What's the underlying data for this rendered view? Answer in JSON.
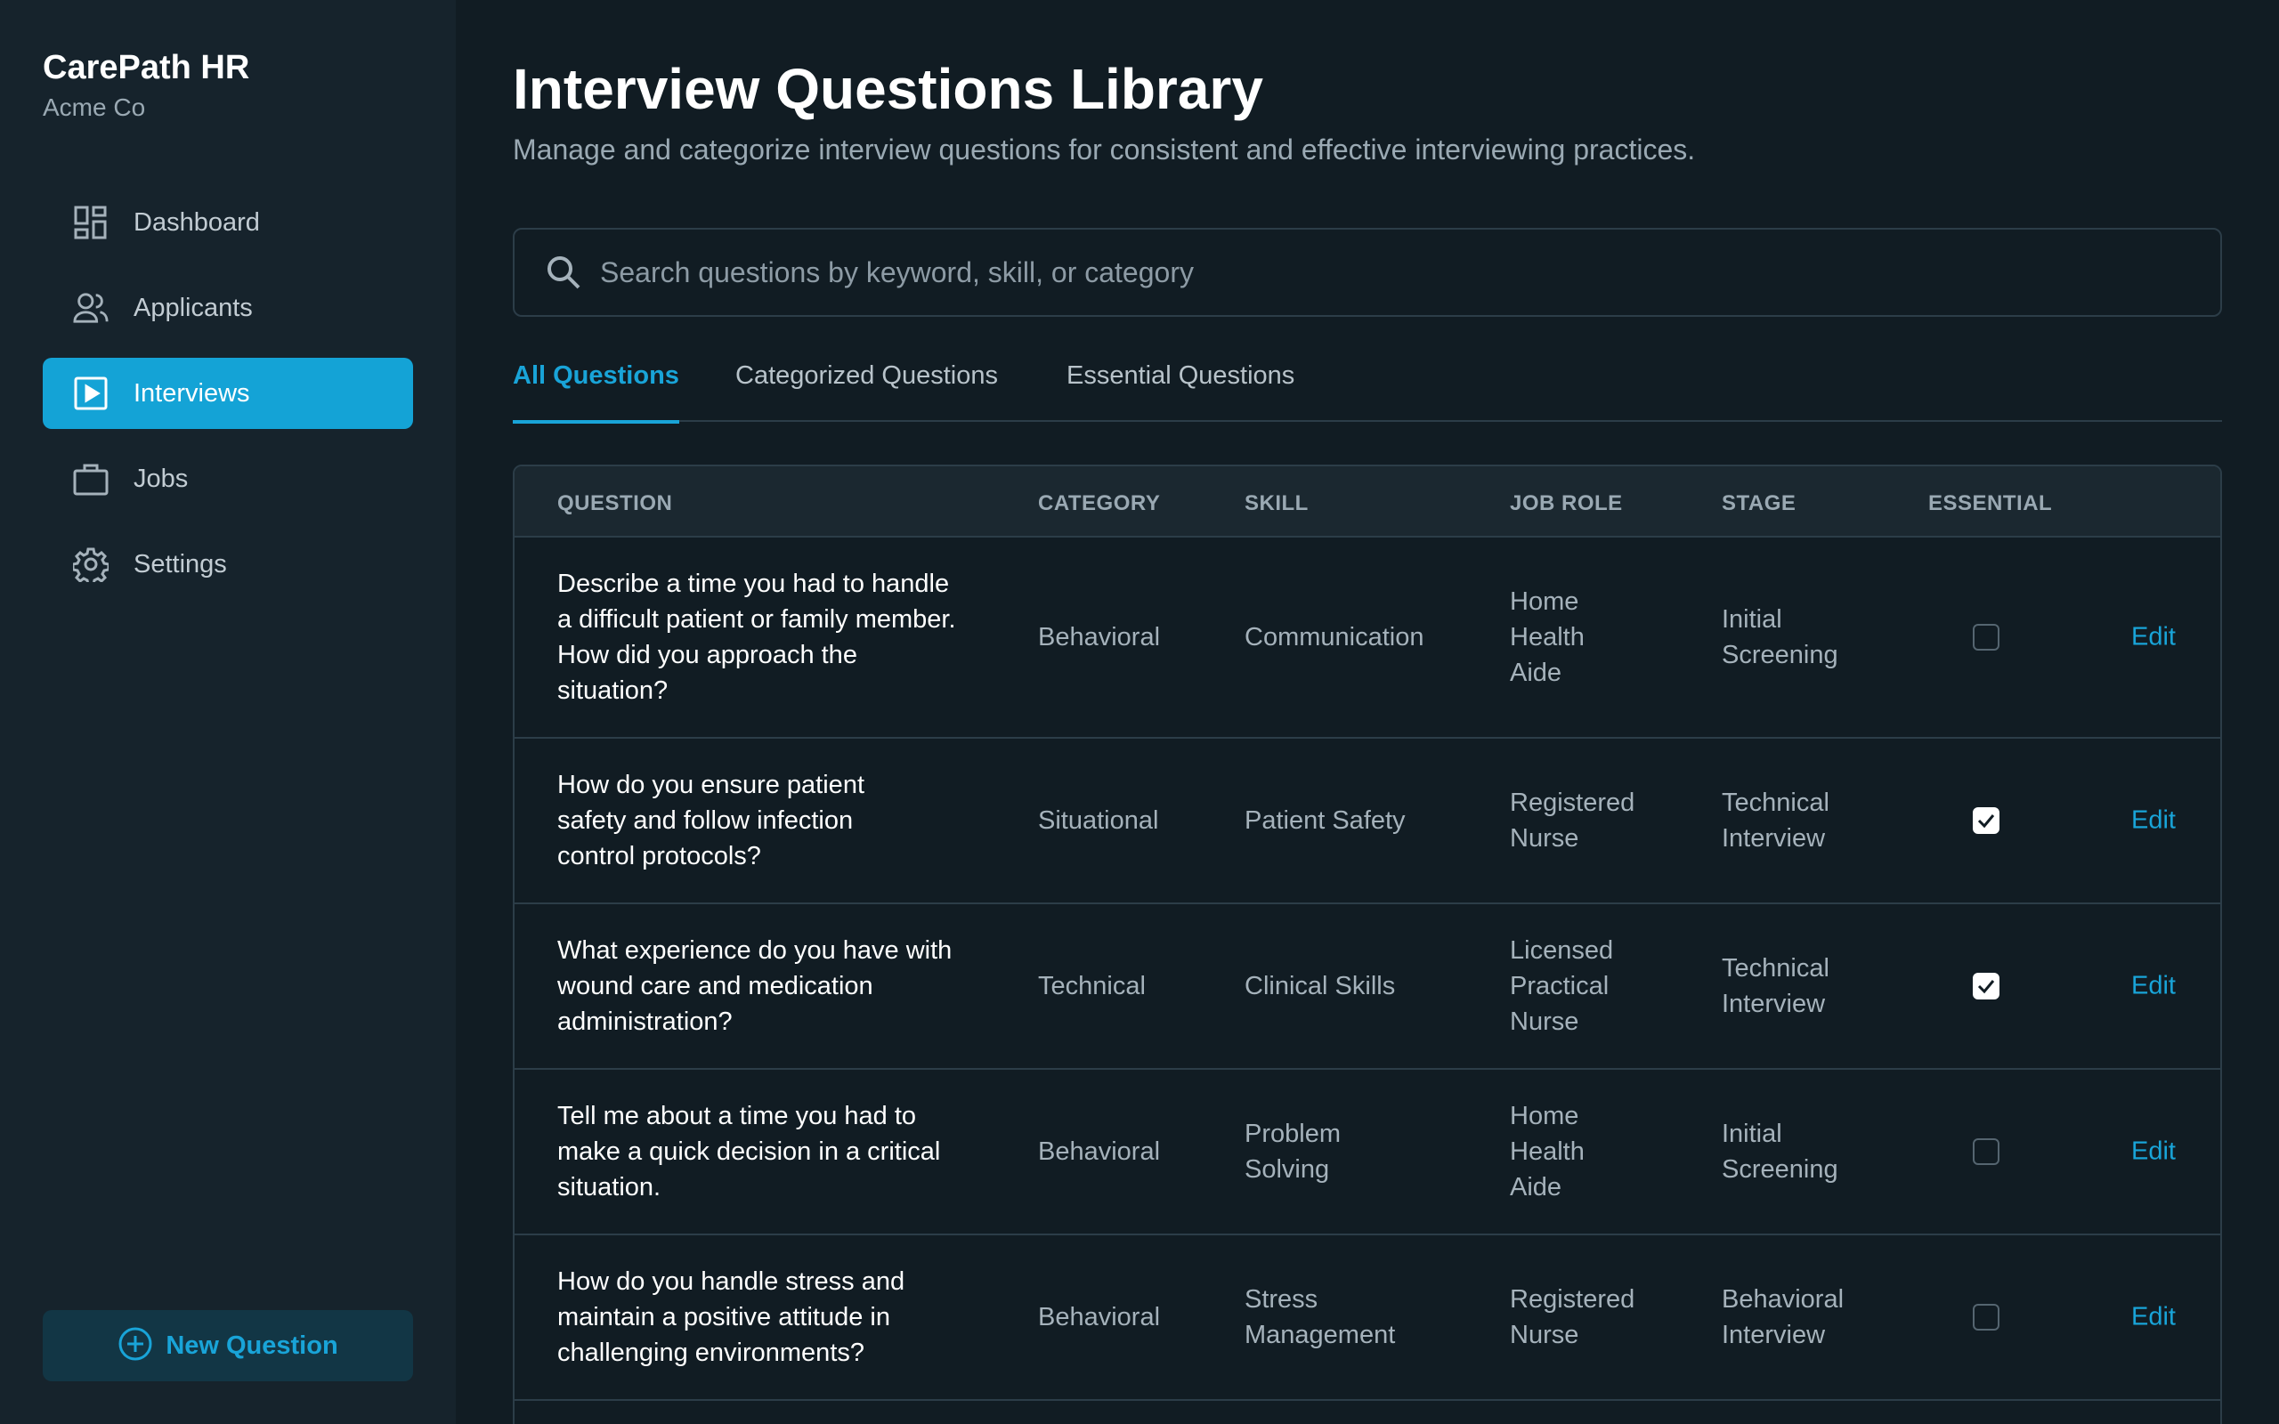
{
  "brand": {
    "title": "CarePath HR",
    "org": "Acme Co"
  },
  "nav": [
    {
      "label": "Dashboard",
      "icon": "dashboard-icon"
    },
    {
      "label": "Applicants",
      "icon": "people-icon"
    },
    {
      "label": "Interviews",
      "icon": "play-square-icon",
      "active": true
    },
    {
      "label": "Jobs",
      "icon": "briefcase-icon"
    },
    {
      "label": "Settings",
      "icon": "gear-icon"
    }
  ],
  "new_question_label": "New Question",
  "page": {
    "title": "Interview Questions Library",
    "subtitle": "Manage and categorize interview questions for consistent and effective interviewing practices."
  },
  "search": {
    "placeholder": "Search questions by keyword, skill, or category",
    "value": ""
  },
  "tabs": [
    {
      "label": "All Questions",
      "active": true
    },
    {
      "label": "Categorized Questions"
    },
    {
      "label": "Essential Questions"
    }
  ],
  "table": {
    "headers": [
      "QUESTION",
      "CATEGORY",
      "SKILL",
      "JOB ROLE",
      "STAGE",
      "ESSENTIAL"
    ],
    "edit_label": "Edit",
    "rows": [
      {
        "question": "Describe a time you had to handle a difficult patient or family member. How did you approach the situation?",
        "category": "Behavioral",
        "skill": "Communication",
        "job_role": "Home Health Aide",
        "stage": "Initial Screening",
        "essential": false
      },
      {
        "question": "How do you ensure patient safety and follow infection control protocols?",
        "category": "Situational",
        "skill": "Patient Safety",
        "job_role": "Registered Nurse",
        "stage": "Technical Interview",
        "essential": true
      },
      {
        "question": "What experience do you have with wound care and medication administration?",
        "category": "Technical",
        "skill": "Clinical Skills",
        "job_role": "Licensed Practical Nurse",
        "stage": "Technical Interview",
        "essential": true
      },
      {
        "question": "Tell me about a time you had to make a quick decision in a critical situation.",
        "category": "Behavioral",
        "skill": "Problem Solving",
        "job_role": "Home Health Aide",
        "stage": "Initial Screening",
        "essential": false
      },
      {
        "question": "How do you handle stress and maintain a positive attitude in challenging environments?",
        "category": "Behavioral",
        "skill": "Stress Management",
        "job_role": "Registered Nurse",
        "stage": "Behavioral Interview",
        "essential": false
      }
    ]
  },
  "colors": {
    "accent": "#14a3d6",
    "background": "#111c23",
    "sidebar": "#16232c"
  }
}
